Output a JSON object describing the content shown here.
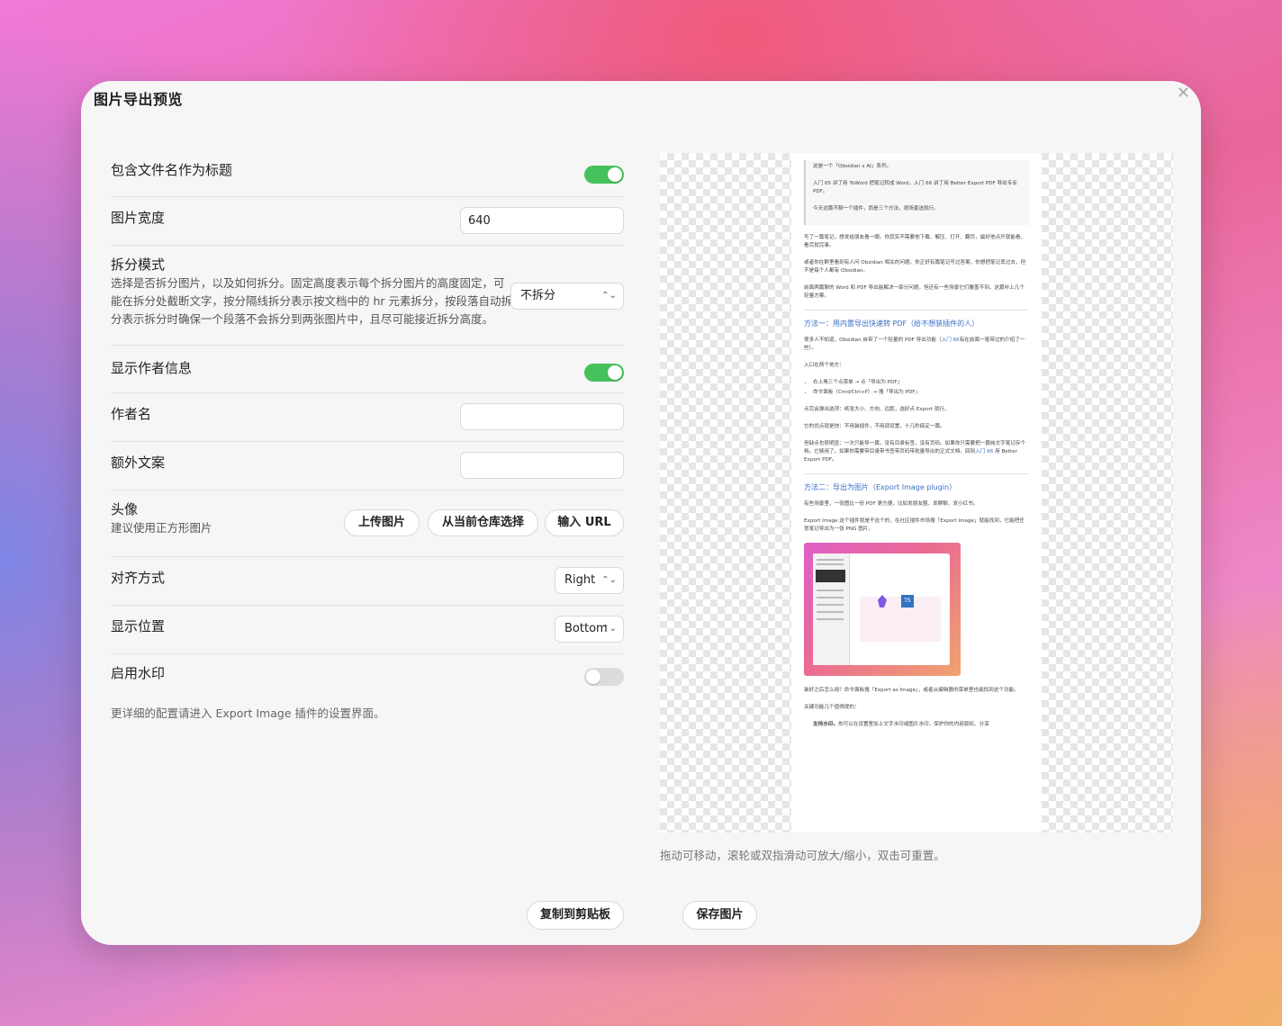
{
  "dialog": {
    "title": "图片导出预览",
    "close_icon": "close-icon"
  },
  "settings": {
    "include_filename": {
      "label": "包含文件名作为标题",
      "enabled": true
    },
    "image_width": {
      "label": "图片宽度",
      "value": "640"
    },
    "split_mode": {
      "label": "拆分模式",
      "description_lines": [
        "选择是否拆分图片，以及如何拆分。固定高度表示每个拆分图片的高度固定，可",
        "能在拆分处截断文字，按分隔线拆分表示按文档中的 hr 元素拆分，按段落自动拆",
        "分表示拆分时确保一个段落不会拆分到两张图片中，且尽可能接近拆分高度。"
      ],
      "value": "不拆分"
    },
    "show_author": {
      "label": "显示作者信息",
      "enabled": true
    },
    "author_name": {
      "label": "作者名",
      "value": ""
    },
    "extra_text": {
      "label": "额外文案",
      "value": ""
    },
    "avatar": {
      "label": "头像",
      "hint": "建议使用正方形图片",
      "upload_label": "上传图片",
      "vault_label": "从当前仓库选择",
      "url_label": "输入 URL"
    },
    "alignment": {
      "label": "对齐方式",
      "value": "Right"
    },
    "position": {
      "label": "显示位置",
      "value": "Bottom"
    },
    "watermark": {
      "label": "启用水印",
      "enabled": false
    }
  },
  "note": "更详细的配置请进入 Export Image 插件的设置界面。",
  "preview": {
    "quote": [
      "这是一个「Obsidian x AI」系列。",
      "入门 65 讲了用 ToWord 把笔记转成 Word，入门 66 讲了用 Better Export PDF 导出专业 PDF。",
      "今天这篇不聊一个插件，而是三个方法，按场景选就行。"
    ],
    "paragraphs_a": [
      "写了一篇笔记，想发给朋友看一眼。你其实不需要他下载、解压、打开、翻页，最好他点开就能看，看完就完事。",
      "或者你在群里看到有人问 Obsidian 相关的问题，你正好有篇笔记写过答案，你想把笔记丢过去，但不是每个人都有 Obsidian。",
      "前面两篇聊的 Word 和 PDF 导出能解决一部分问题，但还有一些场景它们覆盖不到。这篇补上几个轻量方案。"
    ],
    "heading_1": "方法一：用内置导出快速转 PDF（给不想装插件的人）",
    "method1_intro_pre": "很多人不知道，Obsidian 自带了一个轻量的 PDF 导出功能（",
    "method1_intro_link": "入门 66",
    "method1_intro_post": "有在前面一笔带过的介绍了一些）。",
    "entry_label": "入口在两个地方：",
    "entry_items": [
      "右上角三个点菜单 → 点「导出为 PDF」",
      "命令面板（Cmd/Ctrl+P）→ 搜「导出为 PDF」"
    ],
    "paragraphs_b": [
      "点完会弹出选项：纸张大小、方向、边距，选好点 Export 就行。",
      "它的优点就是快：不用装插件，不用调设置，十几秒搞定一篇。"
    ],
    "drawback_pre": "但缺点也很明显：一次只能导一篇，没有目录标签，没有页码。如果你只需要把一篇纯文字笔记存个档，它够用了。如果你需要带目录带书签带页码带批量导出的正式文档，回到",
    "drawback_link": "入门 66",
    "drawback_post": " 用 Better Export PDF。",
    "heading_2": "方法二：导出为图片（Export Image plugin）",
    "paragraphs_c": [
      "有些场景里，一张图比一份 PDF 更方便，比如发朋友圈、发群聊、发小红书。",
      "Export Image 这个插件就是干这个的，在社区插件市场搜「Export Image」就能找到，它能把任意笔记导出为一张 PNG 图片。"
    ],
    "thumb_ts": "TS",
    "paragraphs_d": [
      "装好之后怎么用？命令面板搜「Export as Image」，或者从编辑器的菜单里也能找到这个功能。",
      "关键功能几个值得提的："
    ],
    "tail_bold": "支持水印。",
    "tail_text": "你可以在设置里加上文字水印或图片水印，保护你的内容版权。分享"
  },
  "hint": "拖动可移动，滚轮或双指滑动可放大/缩小，双击可重置。",
  "footer": {
    "copy_label": "复制到剪贴板",
    "save_label": "保存图片"
  },
  "colors": {
    "toggle_on": "#46c25c",
    "toggle_off": "#dcdcdc",
    "link": "#3a6fc8"
  }
}
